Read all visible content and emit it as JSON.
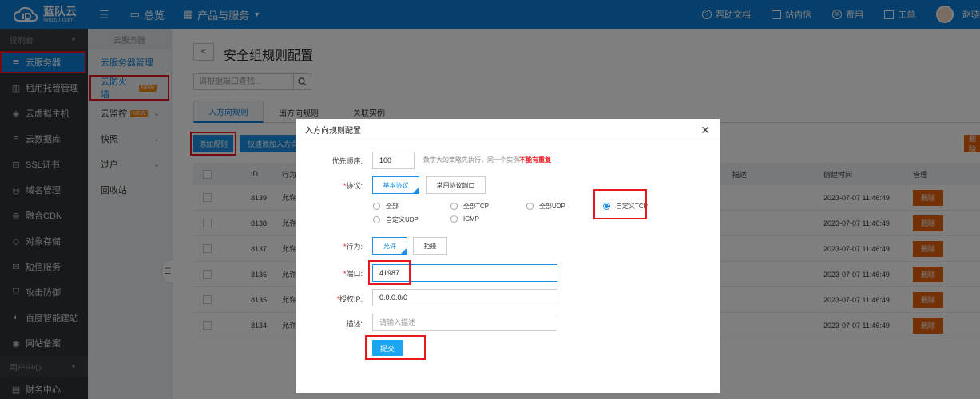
{
  "topbar": {
    "brand_cn": "蓝队云",
    "brand_en": "landui.com",
    "menu_icon": "menu-icon",
    "overview": "总览",
    "products": "产品与服务",
    "help": "帮助文档",
    "messages": "站内信",
    "fees": "费用",
    "tickets": "工单",
    "user": "赵晓"
  },
  "sidebar": {
    "header": "控制台",
    "items": [
      {
        "label": "云服务器",
        "icon": "server-icon",
        "glyph": "≣"
      },
      {
        "label": "租用托管管理",
        "icon": "hosting-icon",
        "glyph": "▥"
      },
      {
        "label": "云虚拟主机",
        "icon": "cube-icon",
        "glyph": "◈"
      },
      {
        "label": "云数据库",
        "icon": "database-icon",
        "glyph": "≡"
      },
      {
        "label": "SSL证书",
        "icon": "certificate-icon",
        "glyph": "⊡"
      },
      {
        "label": "域名管理",
        "icon": "globe-icon",
        "glyph": "◎"
      },
      {
        "label": "融合CDN",
        "icon": "cdn-icon",
        "glyph": "⊗"
      },
      {
        "label": "对象存储",
        "icon": "storage-icon",
        "glyph": "◇"
      },
      {
        "label": "短信服务",
        "icon": "mail-icon",
        "glyph": "✉"
      },
      {
        "label": "攻击防御",
        "icon": "shield-icon",
        "glyph": "⛉"
      },
      {
        "label": "百度智能建站",
        "icon": "site-builder-icon",
        "glyph": "◐"
      },
      {
        "label": "网站备案",
        "icon": "record-icon",
        "glyph": "◉"
      }
    ],
    "user_header": "用户中心",
    "finance": {
      "label": "财务中心",
      "icon": "finance-icon",
      "glyph": "▤"
    }
  },
  "subnav": {
    "header": "云服务器",
    "items": [
      {
        "label": "云服务器管理"
      },
      {
        "label": "云防火墙",
        "badge": "NEW"
      },
      {
        "label": "云监控",
        "badge": "NEW"
      },
      {
        "label": "快照"
      },
      {
        "label": "过户"
      },
      {
        "label": "回收站"
      }
    ]
  },
  "main": {
    "title": "安全组规则配置",
    "search_placeholder": "请根据端口查找...",
    "tabs": [
      "入方向规则",
      "出方向规则",
      "关联实例"
    ],
    "add_button": "添加规则",
    "quick_button": "快速添加入方向规则",
    "right_button": "删除",
    "columns": {
      "id": "ID",
      "action": "行为",
      "desc": "描述",
      "created": "创建时间",
      "manage": "管理"
    },
    "rows": [
      {
        "id": "8139",
        "action": "允许",
        "created": "2023-07-07 11:46:49"
      },
      {
        "id": "8138",
        "action": "允许",
        "created": "2023-07-07 11:46:49"
      },
      {
        "id": "8137",
        "action": "允许",
        "created": "2023-07-07 11:46:49"
      },
      {
        "id": "8136",
        "action": "允许",
        "created": "2023-07-07 11:46:49"
      },
      {
        "id": "8135",
        "action": "允许",
        "created": "2023-07-07 11:46:49"
      },
      {
        "id": "8134",
        "action": "允许",
        "created": "2023-07-07 11:46:49"
      }
    ],
    "delete_label": "删除"
  },
  "modal": {
    "title": "入方向规则配置",
    "priority_label": "优先顺序:",
    "priority_value": "100",
    "priority_hint": "数字大的策略先执行，同一个实例",
    "priority_hint_warn": "不能有重复",
    "protocol_label": "协议:",
    "protocol_tabs": [
      "基本协议",
      "常用协议端口"
    ],
    "protocol_options": [
      "全部",
      "全部TCP",
      "全部UDP",
      "自定义TCP",
      "自定义UDP",
      "ICMP"
    ],
    "selected_protocol": "自定义TCP",
    "action_label": "行为:",
    "action_options": [
      "允许",
      "拒接"
    ],
    "port_label": "端口:",
    "port_value": "41987",
    "ip_label": "授权IP:",
    "ip_value": "0.0.0.0/0",
    "desc_label": "描述:",
    "desc_placeholder": "请输入描述",
    "submit": "提交"
  }
}
